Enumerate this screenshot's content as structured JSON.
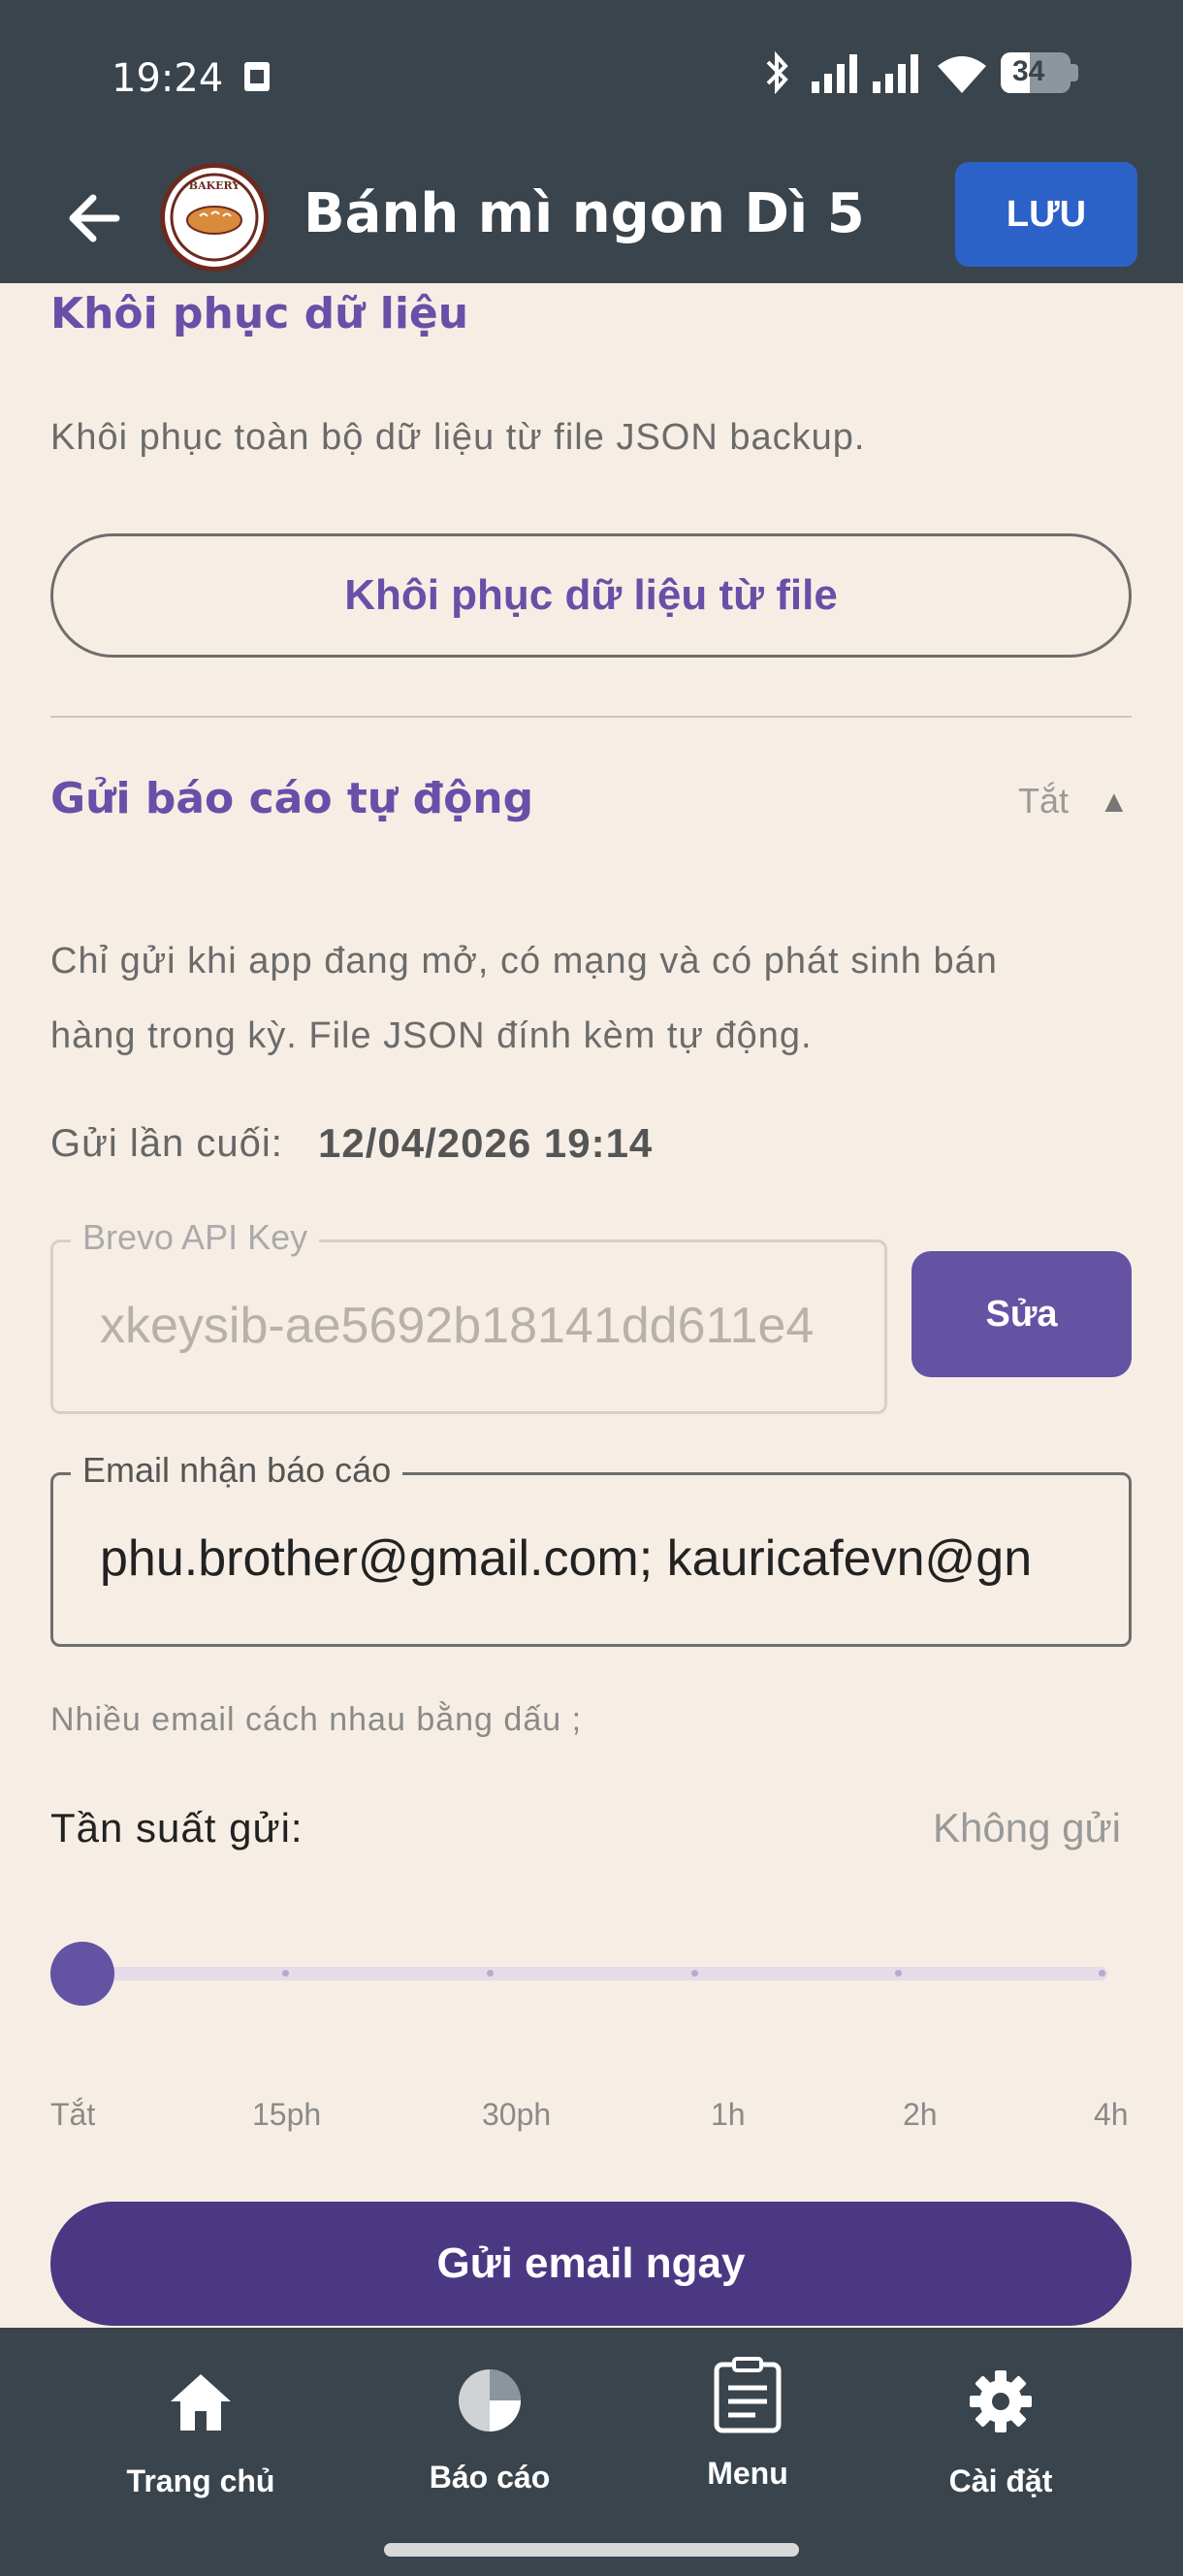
{
  "status_bar": {
    "time": "19:24",
    "battery": "34"
  },
  "app_bar": {
    "title": "Bánh mì ngon Dì 5",
    "save_label": "LƯU"
  },
  "restore": {
    "title": "Khôi phục dữ liệu",
    "description": "Khôi phục toàn bộ dữ liệu từ file JSON backup.",
    "button_label": "Khôi phục dữ liệu từ file"
  },
  "auto_report": {
    "title": "Gửi báo cáo tự động",
    "status": "Tắt",
    "description_line1": "Chỉ gửi khi app đang mở, có mạng và có phát sinh bán",
    "description_line2": "hàng trong kỳ. File JSON đính kèm tự động.",
    "last_sent_label": "Gửi lần cuối:",
    "last_sent_value": "12/04/2026 19:14",
    "api_key_label": "Brevo API Key",
    "api_key_value": "xkeysib-ae5692b18141dd611e4",
    "edit_label": "Sửa",
    "email_label": "Email nhận báo cáo",
    "email_value": "phu.brother@gmail.com; kauricafevn@gn",
    "email_hint": "Nhiều email cách nhau bằng dấu ;",
    "frequency_label": "Tần suất gửi:",
    "frequency_value": "Không gửi",
    "frequency_options": [
      "Tắt",
      "15ph",
      "30ph",
      "1h",
      "2h",
      "4h"
    ],
    "frequency_selected_index": 0,
    "send_now_label": "Gửi email ngay"
  },
  "bottom_nav": [
    {
      "label": "Trang chủ",
      "icon": "home-icon"
    },
    {
      "label": "Báo cáo",
      "icon": "pie-chart-icon"
    },
    {
      "label": "Menu",
      "icon": "clipboard-icon"
    },
    {
      "label": "Cài đặt",
      "icon": "gear-icon"
    }
  ],
  "colors": {
    "accent": "#6a4fa8",
    "bar": "#39444d",
    "background": "#f6eee5",
    "save": "#2c62c8"
  }
}
